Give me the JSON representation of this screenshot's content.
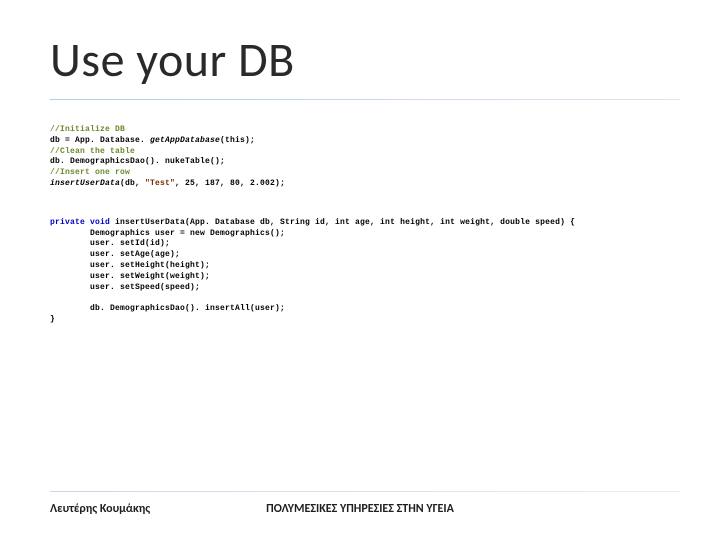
{
  "title": "Use your DB",
  "code1": {
    "c1": "//Initialize DB",
    "l2a": "db = App. Database. ",
    "l2b": "getAppDatabase",
    "l2c": "(this);",
    "c3": "//Clean the table",
    "l4": "db. DemographicsDao(). nukeTable();",
    "c5": "//Insert one row",
    "l6a": "insertUserData",
    "l6b": "(db, ",
    "l6c": "\"Test\"",
    "l6d": ", 25, 187, 80, 2.002);"
  },
  "code2": {
    "l1a": "private void ",
    "l1b": "insertUserData",
    "l1c": "(App. Database db, String id, int age, int height, int weight, double speed) {",
    "l2": "        Demographics user = new Demographics();",
    "l3": "        user. setId(id);",
    "l4": "        user. setAge(age);",
    "l5": "        user. setHeight(height);",
    "l6": "        user. setWeight(weight);",
    "l7": "        user. setSpeed(speed);",
    "blank": "",
    "l8": "        db. DemographicsDao(). insertAll(user);",
    "l9": "}"
  },
  "footer": {
    "left": "Λευτέρης Κουμάκης",
    "center": "ΠΟΛΥΜΕΣΙΚΕΣ ΥΠΗΡΕΣΙΕΣ ΣΤΗΝ ΥΓΕΙΑ"
  }
}
